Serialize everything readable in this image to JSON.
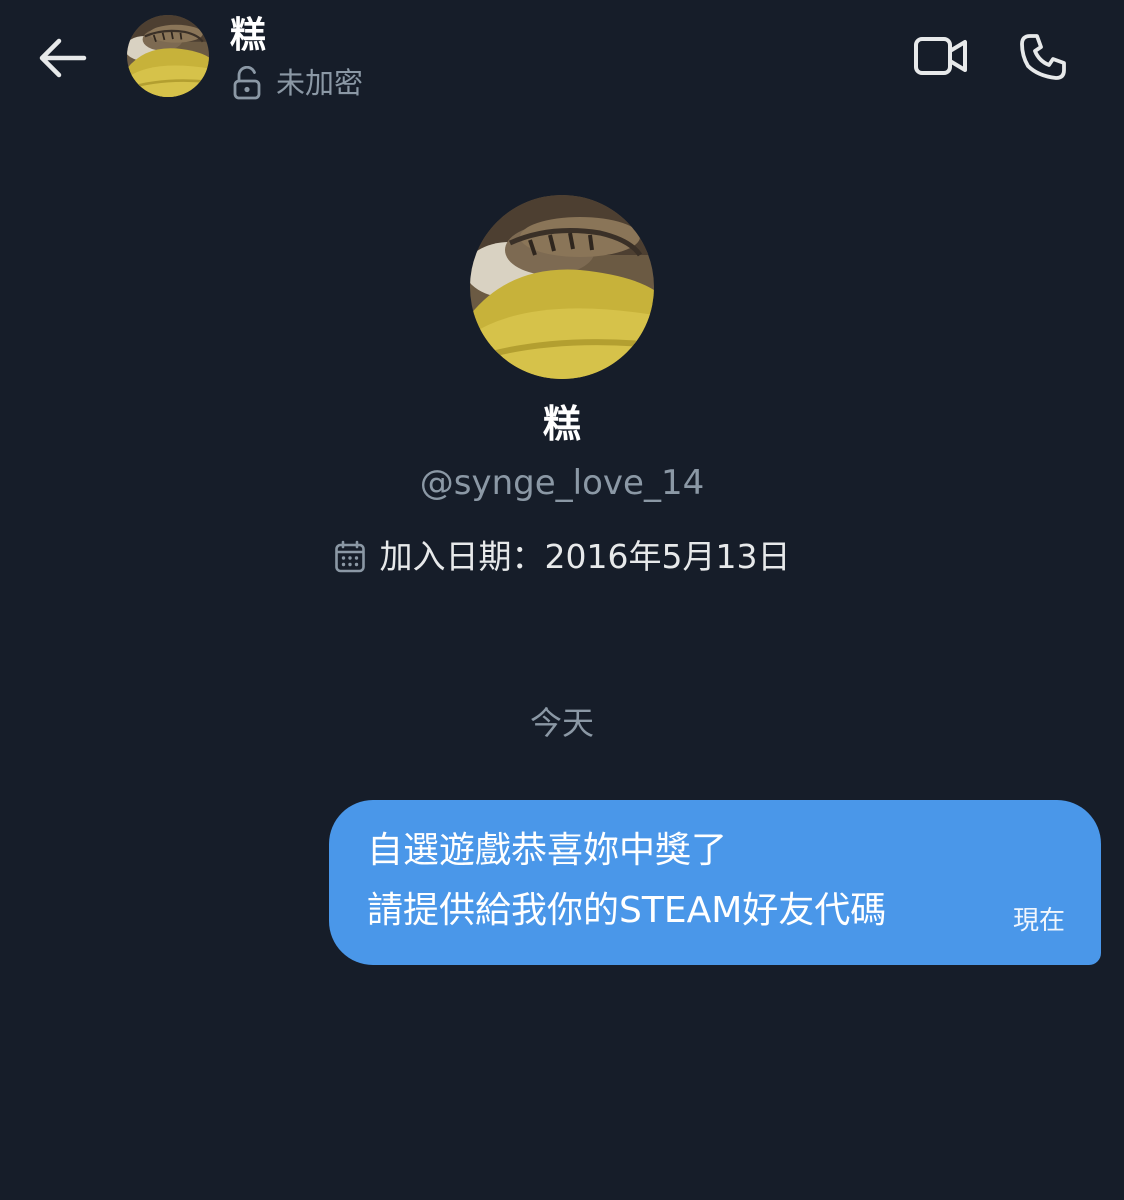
{
  "header": {
    "contact_name": "糕",
    "encryption_status": "未加密"
  },
  "profile": {
    "name": "糕",
    "handle": "@synge_love_14",
    "joined": "加入日期：2016年5月13日"
  },
  "conversation": {
    "date_divider": "今天",
    "messages": [
      {
        "lines": [
          "自選遊戲恭喜妳中獎了",
          "請提供給我你的STEAM好友代碼"
        ],
        "time": "現在",
        "direction": "outgoing"
      }
    ]
  },
  "icons": {
    "back": "back-arrow-icon",
    "lock": "unlocked-padlock-icon",
    "video": "video-camera-icon",
    "phone": "phone-icon",
    "calendar": "calendar-icon"
  },
  "colors": {
    "background": "#161d29",
    "bubble": "#4a97e9",
    "secondary_text": "#8b98a5",
    "primary_text": "#ffffff"
  }
}
